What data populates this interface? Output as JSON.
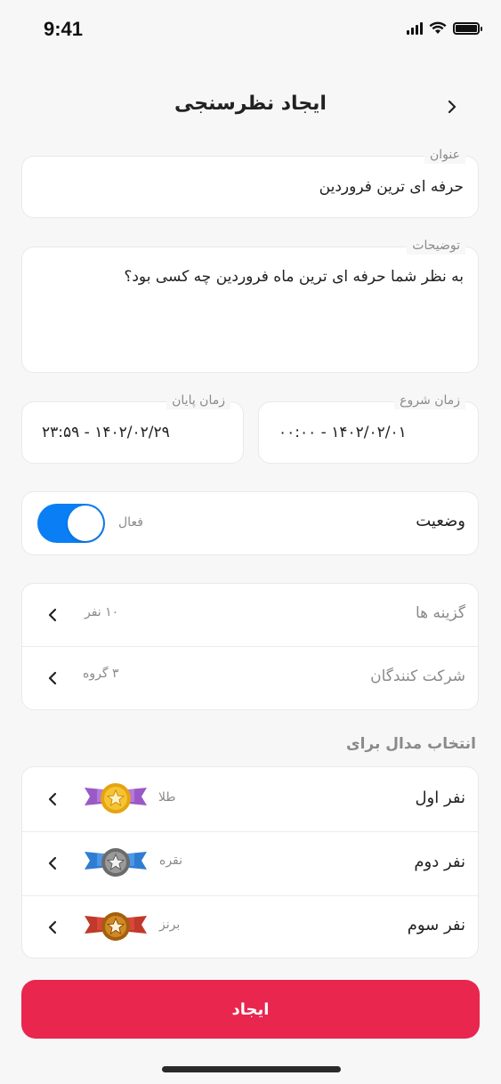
{
  "status_bar": {
    "time": "9:41"
  },
  "header": {
    "title": "ایجاد نظرسنجی"
  },
  "title_field": {
    "label": "عنوان",
    "value": "حرفه ای ترین فروردین"
  },
  "description_field": {
    "label": "توضیحات",
    "value": "به نظر شما حرفه ای ترین ماه فروردین چه کسی بود؟"
  },
  "end_time": {
    "label": "زمان پایان",
    "value": "۱۴۰۲/۰۲/۲۹ - ۲۳:۵۹"
  },
  "start_time": {
    "label": "زمان شروع",
    "value": "۱۴۰۲/۰۲/۰۱ - ۰۰:۰۰"
  },
  "status": {
    "label": "وضعیت",
    "state_label": "فعال",
    "enabled": true
  },
  "options_row": {
    "label": "گزینه ها",
    "value": "۱۰ نفر"
  },
  "participants_row": {
    "label": "شرکت کنندگان",
    "value": "۳ گروه"
  },
  "medal_section": {
    "title": "انتخاب مدال برای",
    "items": [
      {
        "label": "نفر اول",
        "medal": "طلا"
      },
      {
        "label": "نفر دوم",
        "medal": "نقره"
      },
      {
        "label": "نفر سوم",
        "medal": "برنز"
      }
    ]
  },
  "create_button": {
    "label": "ایجاد"
  },
  "colors": {
    "accent": "#0a7ef5",
    "primary_button": "#e8264e",
    "gold": "#f2b824",
    "silver": "#8e8e8e",
    "bronze": "#d18a23"
  }
}
